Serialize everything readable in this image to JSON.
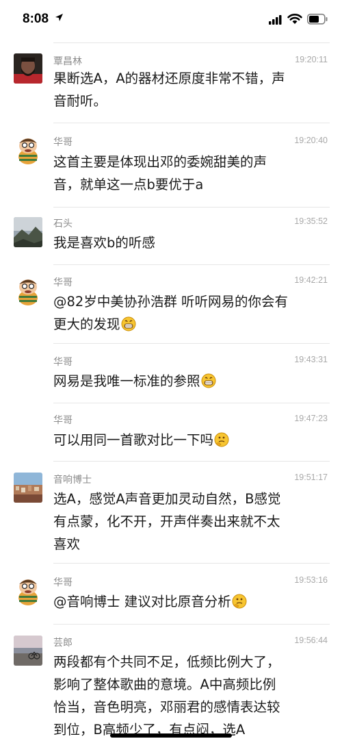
{
  "status_bar": {
    "time": "8:08"
  },
  "comments": [
    {
      "name": "覃昌林",
      "time": "19:20:11",
      "lines": [
        "果断选A，A的器材还原度非常不错，声",
        "音耐听。"
      ],
      "avatar": "man-portrait"
    },
    {
      "name": "华哥",
      "time": "19:20:40",
      "lines": [
        "这首主要是体现出邓的委婉甜美的声",
        "音，就单这一点b要优于a"
      ],
      "avatar": "cartoon-man"
    },
    {
      "name": "石头",
      "time": "19:35:52",
      "lines": [
        "我是喜欢b的听感"
      ],
      "avatar": "mountain-photo"
    },
    {
      "name": "华哥",
      "time": "19:42:21",
      "lines": [
        "@82岁中美协孙浩群 听听网易的你会有",
        "更大的发现"
      ],
      "emoji": "grin",
      "avatar": "cartoon-man"
    },
    {
      "name": "华哥",
      "time": "19:43:31",
      "lines": [
        "网易是我唯一标准的参照"
      ],
      "emoji": "grin"
    },
    {
      "name": "华哥",
      "time": "19:47:23",
      "lines": [
        "可以用同一首歌对比一下吗"
      ],
      "emoji": "thinking"
    },
    {
      "name": "音响博士",
      "time": "19:51:17",
      "lines": [
        "选A，感觉A声音更加灵动自然，B感觉",
        "有点蒙，化不开，开声伴奏出来就不太",
        "喜欢"
      ],
      "avatar": "city-photo"
    },
    {
      "name": "华哥",
      "time": "19:53:16",
      "lines": [
        "@音响博士 建议对比原音分析"
      ],
      "emoji": "thinking",
      "avatar": "cartoon-man"
    },
    {
      "name": "芸郎",
      "time": "19:56:44",
      "lines": [
        "两段都有个共同不足，低频比例大了，",
        "影响了整体歌曲的意境。A中高频比例",
        "恰当，音色明亮，邓丽君的感情表达较",
        "到位，B高频少了，有点闷，选A"
      ],
      "avatar": "beach-photo"
    }
  ],
  "colors": {
    "name": "#8a8a8a",
    "timestamp": "#a8a8a8",
    "divider": "#e6e6e6",
    "text": "#1a1a1a"
  }
}
